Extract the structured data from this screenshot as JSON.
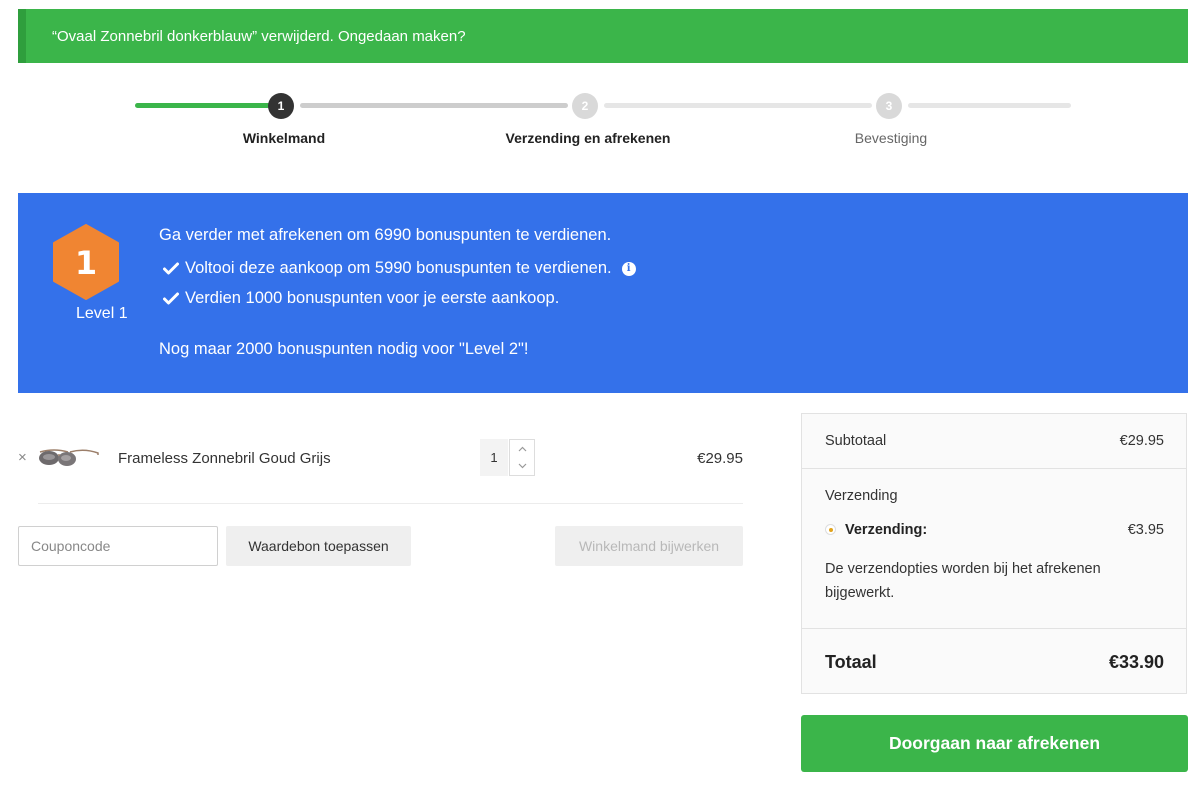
{
  "notice": {
    "message": "“Ovaal Zonnebril donkerblauw” verwijderd. Ongedaan maken?"
  },
  "progress": {
    "steps": [
      {
        "number": "1",
        "label": "Winkelmand"
      },
      {
        "number": "2",
        "label": "Verzending en afrekenen"
      },
      {
        "number": "3",
        "label": "Bevestiging"
      }
    ]
  },
  "bonus": {
    "badge_number": "1",
    "level_label": "Level 1",
    "headline": "Ga verder met afrekenen om 6990 bonuspunten te verdienen.",
    "items": [
      "Voltooi deze aankoop om 5990 bonuspunten te verdienen.",
      "Verdien 1000 bonuspunten voor je eerste aankoop."
    ],
    "footer": "Nog maar 2000 bonuspunten nodig voor \"Level 2\"!",
    "colors": {
      "background": "#3471ea",
      "badge": "#f08532"
    }
  },
  "cart": {
    "items": [
      {
        "remove_icon": "close-icon",
        "name": "Frameless Zonnebril Goud Grijs",
        "quantity": "1",
        "price": "€29.95"
      }
    ],
    "coupon_placeholder": "Couponcode",
    "apply_label": "Waardebon toepassen",
    "update_label": "Winkelmand bijwerken"
  },
  "summary": {
    "subtotal_label": "Subtotaal",
    "subtotal_value": "€29.95",
    "shipping_title": "Verzending",
    "shipping_option_label": "Verzending:",
    "shipping_option_value": "€3.95",
    "shipping_note": "De verzendopties worden bij het afrekenen bijgewerkt.",
    "total_label": "Totaal",
    "total_value": "€33.90"
  },
  "checkout": {
    "label": "Doorgaan naar afrekenen",
    "color": "#3bb54a"
  }
}
